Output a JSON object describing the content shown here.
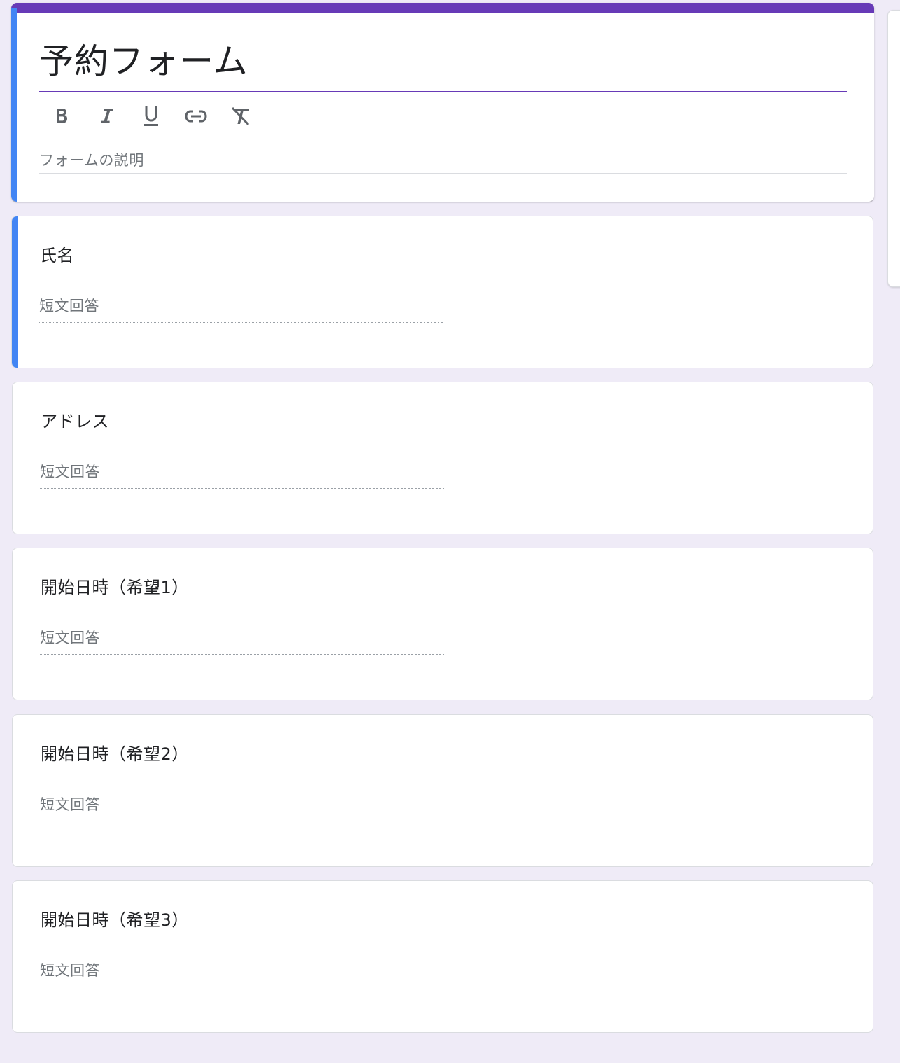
{
  "form": {
    "title": "予約フォーム",
    "description_placeholder": "フォームの説明",
    "accent_color": "#673ab7",
    "active_color": "#4285f4"
  },
  "toolbar": {
    "items": [
      {
        "icon": "bold-icon",
        "label": "B"
      },
      {
        "icon": "italic-icon",
        "label": "I"
      },
      {
        "icon": "underline-icon",
        "label": "U"
      },
      {
        "icon": "link-icon"
      },
      {
        "icon": "clear-format-icon"
      }
    ]
  },
  "questions": [
    {
      "title": "氏名",
      "placeholder": "短文回答"
    },
    {
      "title": "アドレス",
      "placeholder": "短文回答"
    },
    {
      "title": "開始日時（希望1）",
      "placeholder": "短文回答"
    },
    {
      "title": "開始日時（希望2）",
      "placeholder": "短文回答"
    },
    {
      "title": "開始日時（希望3）",
      "placeholder": "短文回答"
    }
  ]
}
